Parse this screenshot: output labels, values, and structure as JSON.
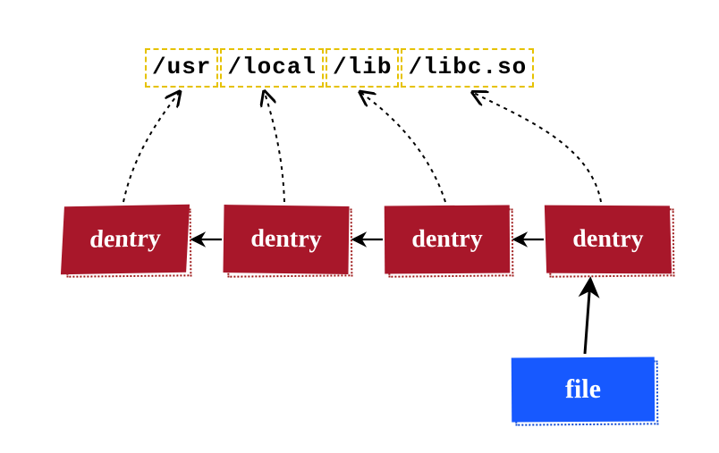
{
  "path_segments": [
    "/usr",
    "/local",
    "/lib",
    "/libc.so"
  ],
  "dentries": [
    "dentry",
    "dentry",
    "dentry",
    "dentry"
  ],
  "file_label": "file",
  "colors": {
    "dentry_fill": "#a8172a",
    "dentry_outline": "#9e1a1a",
    "file_fill": "#1759ff",
    "file_outline": "#0d47d1",
    "segment_border": "#e6c200",
    "arrow": "#000000"
  }
}
